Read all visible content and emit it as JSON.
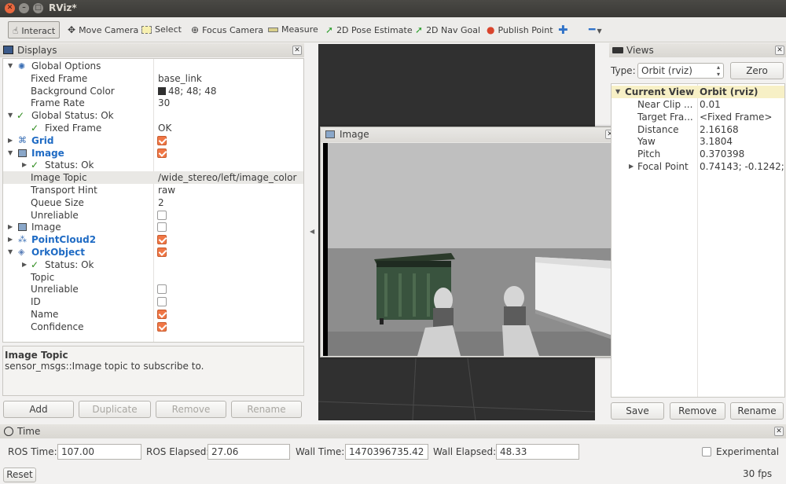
{
  "window": {
    "title": "RViz*"
  },
  "toolbar": {
    "interact": "Interact",
    "move_camera": "Move Camera",
    "select": "Select",
    "focus_camera": "Focus Camera",
    "measure": "Measure",
    "pose_estimate": "2D Pose Estimate",
    "nav_goal": "2D Nav Goal",
    "publish_point": "Publish Point"
  },
  "displays": {
    "title": "Displays",
    "rows": [
      {
        "label": "Global Options",
        "value": ""
      },
      {
        "label": "Fixed Frame",
        "value": "base_link"
      },
      {
        "label": "Background Color",
        "value": "48; 48; 48"
      },
      {
        "label": "Frame Rate",
        "value": "30"
      },
      {
        "label": "Global Status: Ok",
        "value": ""
      },
      {
        "label": "Fixed Frame",
        "value": "OK"
      },
      {
        "label": "Grid",
        "value": ""
      },
      {
        "label": "Image",
        "value": ""
      },
      {
        "label": "Status: Ok",
        "value": ""
      },
      {
        "label": "Image Topic",
        "value": "/wide_stereo/left/image_color"
      },
      {
        "label": "Transport Hint",
        "value": "raw"
      },
      {
        "label": "Queue Size",
        "value": "2"
      },
      {
        "label": "Unreliable",
        "value": ""
      },
      {
        "label": "Image",
        "value": ""
      },
      {
        "label": "PointCloud2",
        "value": ""
      },
      {
        "label": "OrkObject",
        "value": ""
      },
      {
        "label": "Status: Ok",
        "value": ""
      },
      {
        "label": "Topic",
        "value": ""
      },
      {
        "label": "Unreliable",
        "value": ""
      },
      {
        "label": "ID",
        "value": ""
      },
      {
        "label": "Name",
        "value": ""
      },
      {
        "label": "Confidence",
        "value": ""
      }
    ],
    "desc_title": "Image Topic",
    "desc_text": "sensor_msgs::Image topic to subscribe to.",
    "buttons": {
      "add": "Add",
      "duplicate": "Duplicate",
      "remove": "Remove",
      "rename": "Rename"
    }
  },
  "image_panel": {
    "title": "Image"
  },
  "views": {
    "title": "Views",
    "type_label": "Type:",
    "type_value": "Orbit (rviz)",
    "zero": "Zero",
    "header_key": "Current View",
    "header_value": "Orbit (rviz)",
    "rows": [
      {
        "label": "Near Clip ...",
        "value": "0.01"
      },
      {
        "label": "Target Fra...",
        "value": "<Fixed Frame>"
      },
      {
        "label": "Distance",
        "value": "2.16168"
      },
      {
        "label": "Yaw",
        "value": "3.1804"
      },
      {
        "label": "Pitch",
        "value": "0.370398"
      },
      {
        "label": "Focal Point",
        "value": "0.74143; -0.1242;..."
      }
    ],
    "buttons": {
      "save": "Save",
      "remove": "Remove",
      "rename": "Rename"
    }
  },
  "time": {
    "title": "Time",
    "ros_time_label": "ROS Time:",
    "ros_time": "107.00",
    "ros_elapsed_label": "ROS Elapsed:",
    "ros_elapsed": "27.06",
    "wall_time_label": "Wall Time:",
    "wall_time": "1470396735.42",
    "wall_elapsed_label": "Wall Elapsed:",
    "wall_elapsed": "48.33",
    "experimental": "Experimental",
    "reset": "Reset",
    "fps": "30 fps"
  },
  "colors": {
    "accent": "#f07746",
    "link_blue": "#1f6bc4",
    "check_green": "#2c8a1b",
    "viewport": "#303030"
  }
}
